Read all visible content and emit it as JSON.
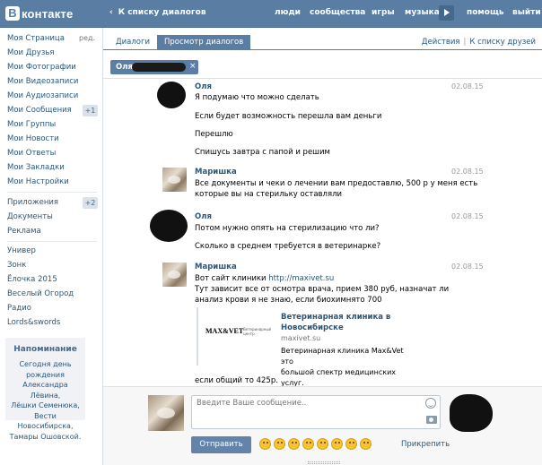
{
  "header": {
    "logo_mark": "В",
    "logo_text": "контакте",
    "back_arrow": "‹",
    "back_label": "К списку диалогов",
    "nav": [
      "люди",
      "сообщества",
      "игры",
      "музыка"
    ],
    "help": "помощь",
    "logout": "выйти"
  },
  "sidebar": {
    "edit_label": "ред.",
    "items": [
      "Моя Страница",
      "Мои Друзья",
      "Мои Фотографии",
      "Мои Видеозаписи",
      "Мои Аудиозаписи",
      "Мои Сообщения",
      "Мои Группы",
      "Мои Новости",
      "Мои Ответы",
      "Мои Закладки",
      "Мои Настройки"
    ],
    "messages_badge": "+1",
    "apps_items": [
      "Приложения",
      "Документы",
      "Реклама"
    ],
    "apps_badge": "+2",
    "games_items": [
      "Универ",
      "Зонк",
      "Ёлочка 2015",
      "Веселый Огород",
      "Радио",
      "Lords&swords"
    ],
    "reminder": {
      "title": "Напоминание",
      "lines": [
        "Сегодня день",
        "рождения",
        "Александра Лёвина,",
        "Лёшки Семенюка,",
        "Вести Новосибирска,",
        "Тамары Ошовской."
      ]
    }
  },
  "main": {
    "tabs": [
      "Диалоги",
      "Просмотр диалогов"
    ],
    "actions_label": "Действия",
    "actions_sep": "|",
    "friends_link": "К списку друзей",
    "chip_name": "Оля",
    "chip_close": "×"
  },
  "messages": [
    {
      "author": "Оля",
      "date": "02.08.15",
      "lines": [
        "Я подумаю что можно сделать",
        "Если будет возможность перешла вам деньги",
        "Перешлю",
        "Спишусь завтра с папой и решим"
      ]
    },
    {
      "author": "Маришка",
      "date": "02.08.15",
      "lines": [
        "Все документы и чеки о лечении вам предоставлю, 500 р у меня есть",
        "которые вы на стерильку оставляли"
      ]
    },
    {
      "author": "Оля",
      "date": "02.08.15",
      "lines": [
        "Потом нужно опять на стерилизацию что ли?",
        "Сколько в среднем требуется в ветеринарке?"
      ]
    },
    {
      "author": "Маришка",
      "date": "02.08.15",
      "site_prefix": "Вот сайт клиники ",
      "site_url": "http://maxivet.su",
      "lines": [
        "Тут зависит все от осмотра врача, прием 380 руб, назначат ли",
        "анализ крови я не знаю, если биохимнято 700"
      ],
      "snippet": {
        "logo": "MAX&VET",
        "logo_sub": "Ветеринарный центр",
        "title_1": "Ветеринарная клиника в",
        "title_2": "Новосибирске",
        "domain": "maxivet.su",
        "desc_1": "Ветеринарная клиника Max&Vet это",
        "desc_2": "большой спектр медицинских услуг."
      },
      "tail": "если общий то 425р."
    }
  ],
  "composer": {
    "placeholder": "Введите Ваше сообщение..",
    "send_label": "Отправить",
    "attach_label": "Прикрепить"
  },
  "colors": {
    "header_bg": "#597da3",
    "link": "#2b587a",
    "tab_active": "#597da3",
    "button": "#6383a8"
  }
}
